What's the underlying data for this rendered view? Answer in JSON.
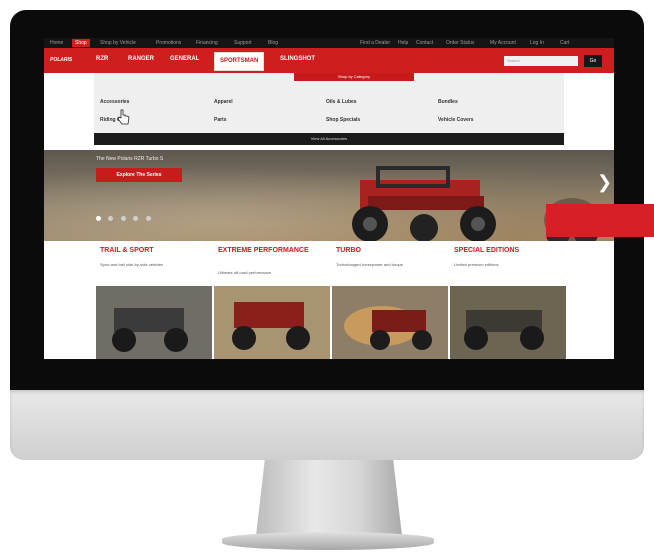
{
  "top_nav": {
    "items": [
      "Home",
      "Shop",
      "Shop by Vehicle",
      "Promotions",
      "Financing",
      "Support",
      "Blog"
    ],
    "active_index": 1,
    "right_items": [
      "Find a Dealer",
      "Help",
      "Contact",
      "Order Status",
      "My Account",
      "Log In",
      "Cart"
    ]
  },
  "main_nav": {
    "logo_text": "POLARIS",
    "items": [
      "RZR",
      "RANGER",
      "GENERAL",
      "SPORTSMAN",
      "SLINGSHOT"
    ],
    "selected_index": 3,
    "search_placeholder": "Search",
    "search_button": "Go"
  },
  "dropdown": {
    "title": "Shop by Category",
    "columns": [
      [
        "Accessories",
        "Riding Gear"
      ],
      [
        "Apparel",
        "Parts"
      ],
      [
        "Oils & Lubes",
        "Shop Specials"
      ],
      [
        "Bundles",
        "Vehicle Covers"
      ]
    ],
    "view_all": "View All Accessories"
  },
  "hero": {
    "text": "The New Polaris RZR Turbo S",
    "button": "Explore The Series",
    "slides": 5,
    "active_slide": 0
  },
  "categories": [
    {
      "title": "TRAIL & SPORT",
      "subtitle": "Sport and trail side-by-side vehicles"
    },
    {
      "title": "EXTREME PERFORMANCE",
      "subtitle": "Ultimate off-road performance"
    },
    {
      "title": "TURBO",
      "subtitle": "Turbocharged horsepower and torque"
    },
    {
      "title": "SPECIAL EDITIONS",
      "subtitle": "Limited premium editions"
    }
  ],
  "colors": {
    "brand_red": "#cf1e1e",
    "bezel": "#0b0b0b",
    "accent_tab": "#d71f26"
  }
}
